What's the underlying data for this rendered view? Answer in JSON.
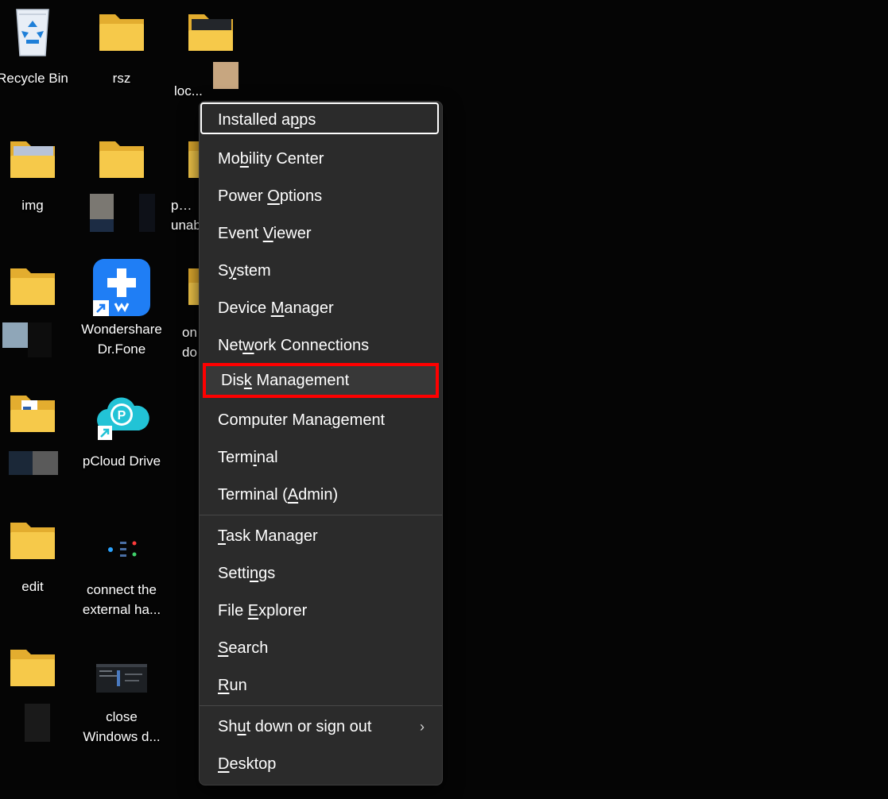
{
  "desktop": {
    "icons": [
      {
        "label": "Recycle Bin"
      },
      {
        "label": "rsz"
      },
      {
        "label": "loc..."
      },
      {
        "label": "img"
      },
      {
        "label": "p…\nunab…"
      },
      {
        "label": "Wondershare\nDr.Fone"
      },
      {
        "label": "on\ndo"
      },
      {
        "label": "pCloud Drive"
      },
      {
        "label": "edit"
      },
      {
        "label": "connect the\nexternal ha..."
      },
      {
        "label": "close\nWindows d..."
      }
    ]
  },
  "menu": {
    "items": [
      {
        "pre": "Installed a",
        "ul": "p",
        "post": "ps"
      },
      {
        "pre": "Mo",
        "ul": "b",
        "post": "ility Center"
      },
      {
        "pre": "Power ",
        "ul": "O",
        "post": "ptions"
      },
      {
        "pre": "Event ",
        "ul": "V",
        "post": "iewer"
      },
      {
        "pre": "S",
        "ul": "y",
        "post": "stem"
      },
      {
        "pre": "Device ",
        "ul": "M",
        "post": "anager"
      },
      {
        "pre": "Net",
        "ul": "w",
        "post": "ork Connections"
      },
      {
        "pre": "Dis",
        "ul": "k",
        "post": " Management"
      },
      {
        "pre": "Computer Mana",
        "ul": "g",
        "post": "ement"
      },
      {
        "pre": "Term",
        "ul": "i",
        "post": "nal"
      },
      {
        "pre": "Terminal (",
        "ul": "A",
        "post": "dmin)"
      },
      {
        "pre": "",
        "ul": "T",
        "post": "ask Manager"
      },
      {
        "pre": "Setti",
        "ul": "n",
        "post": "gs"
      },
      {
        "pre": "File ",
        "ul": "E",
        "post": "xplorer"
      },
      {
        "pre": "",
        "ul": "S",
        "post": "earch"
      },
      {
        "pre": "",
        "ul": "R",
        "post": "un"
      },
      {
        "pre": "Sh",
        "ul": "u",
        "post": "t down or sign out",
        "chevron": "›"
      },
      {
        "pre": "",
        "ul": "D",
        "post": "esktop"
      }
    ]
  },
  "colors": {
    "highlight_border": "#ff0000",
    "menu_bg": "#2b2b2b",
    "desktop_bg": "#050505",
    "folder": "#f6c94a"
  },
  "icons_semantic": [
    "recycle-bin-icon",
    "folder-icon",
    "app-shortcut-icon",
    "cloud-drive-icon",
    "shortcut-arrow-icon",
    "chevron-right-icon"
  ]
}
